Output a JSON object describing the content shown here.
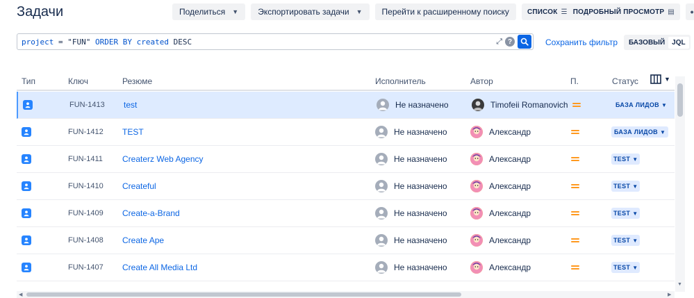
{
  "page": {
    "title": "Задачи"
  },
  "toolbar": {
    "share_label": "Поделиться",
    "export_label": "Экспортировать задачи",
    "advanced_search_label": "Перейти к расширенному поиску",
    "view_list_label": "СПИСОК",
    "view_detail_label": "ПОДРОБНЫЙ ПРОСМОТР",
    "more_label": "•••"
  },
  "search": {
    "jql_parts": [
      "project",
      " = ",
      "\"FUN\"",
      " ORDER BY ",
      "created",
      " DESC"
    ],
    "save_filter_label": "Сохранить фильтр",
    "mode_basic": "БАЗОВЫЙ",
    "mode_jql": "JQL"
  },
  "table": {
    "headers": {
      "type": "Тип",
      "key": "Ключ",
      "summary": "Резюме",
      "assignee": "Исполнитель",
      "author": "Автор",
      "priority": "П.",
      "status": "Статус"
    },
    "rows": [
      {
        "key": "FUN-1413",
        "summary": "test",
        "assignee": "Не назначено",
        "author": "Timofeii Romanovich",
        "status": "БАЗА ЛИДОВ"
      },
      {
        "key": "FUN-1412",
        "summary": "TEST",
        "assignee": "Не назначено",
        "author": "Александр",
        "status": "БАЗА ЛИДОВ"
      },
      {
        "key": "FUN-1411",
        "summary": "Createrz Web Agency",
        "assignee": "Не назначено",
        "author": "Александр",
        "status": "TEST"
      },
      {
        "key": "FUN-1410",
        "summary": "Createful",
        "assignee": "Не назначено",
        "author": "Александр",
        "status": "TEST"
      },
      {
        "key": "FUN-1409",
        "summary": "Create-a-Brand",
        "assignee": "Не назначено",
        "author": "Александр",
        "status": "TEST"
      },
      {
        "key": "FUN-1408",
        "summary": "Create Ape",
        "assignee": "Не назначено",
        "author": "Александр",
        "status": "TEST"
      },
      {
        "key": "FUN-1407",
        "summary": "Create All Media Ltd",
        "assignee": "Не назначено",
        "author": "Александр",
        "status": "TEST"
      }
    ]
  },
  "colors": {
    "accent": "#0c66e4",
    "story_icon": "#2684ff",
    "priority_medium": "#ff991f",
    "selected_row": "#deebff",
    "status_bg": "#dfeaff"
  },
  "icons": {
    "type": "story-icon",
    "priority": "priority-medium-icon",
    "unassigned": "user-avatar-icon",
    "search": "search-icon",
    "help": "help-icon",
    "expand": "expand-icon",
    "columns": "columns-icon"
  }
}
